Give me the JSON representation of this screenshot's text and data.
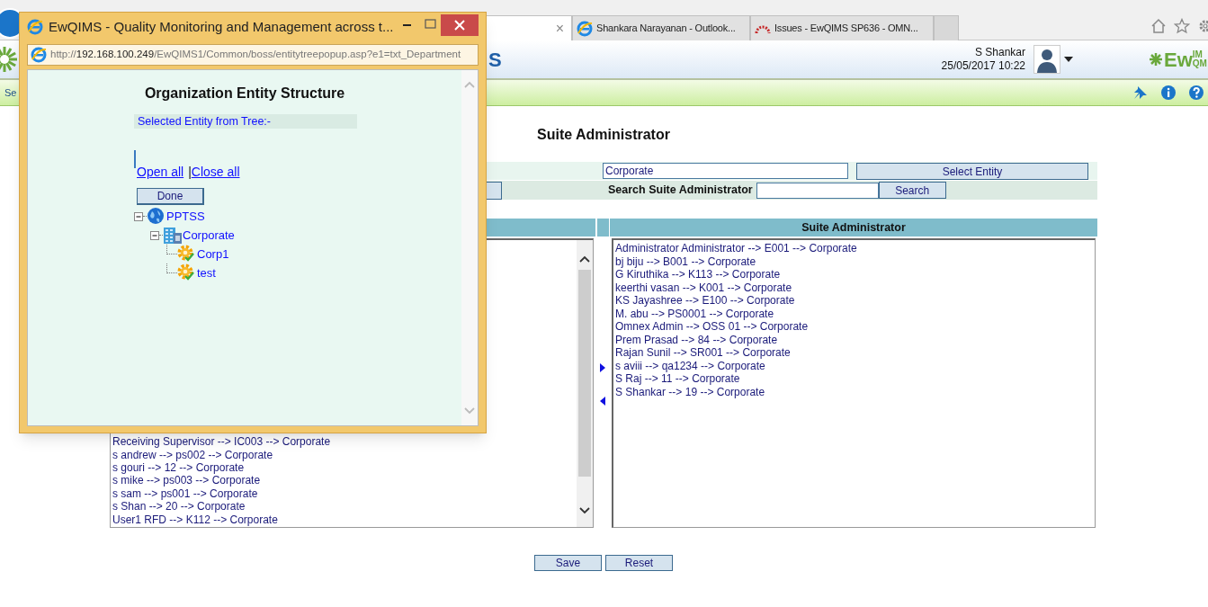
{
  "browser": {
    "tabs": [
      {
        "selected": true,
        "close": "×"
      },
      {
        "title": "Shankara Narayanan - Outlook...",
        "selected": false,
        "kind": "ie"
      },
      {
        "title": "Issues - EwQIMS SP636 - OMN...",
        "selected": false,
        "kind": "arc"
      }
    ]
  },
  "header": {
    "logo_fragment": "S",
    "user": "S Shankar",
    "datetime": "25/05/2017 10:22",
    "brand": "Ew",
    "brand_top": "IM",
    "brand_bottom": "QM"
  },
  "menu_bar": {
    "items": [
      "Se"
    ]
  },
  "page": {
    "title": "Suite Administrator",
    "entity_field": {
      "value": "Corporate"
    },
    "select_entity_button": "Select Entity",
    "search_label": "Search Suite Administrator",
    "search_button": "Search",
    "right_list_header": "Suite Administrator",
    "available_list": [
      "Receiving Supervisor --> IC003 --> Corporate",
      "s andrew --> ps002 --> Corporate",
      "s gouri --> 12 --> Corporate",
      "s mike --> ps003 --> Corporate",
      "s sam --> ps001 --> Corporate",
      "s Shan --> 20 --> Corporate",
      "User1 RFD --> K112 --> Corporate"
    ],
    "assigned_list": [
      "Administrator Administrator --> E001 --> Corporate",
      "bj biju --> B001 --> Corporate",
      "G Kiruthika --> K113 --> Corporate",
      "keerthi vasan --> K001 --> Corporate",
      "KS Jayashree --> E100 --> Corporate",
      "M. abu --> PS0001 --> Corporate",
      "Omnex Admin --> OSS 01 --> Corporate",
      "Prem Prasad --> 84 --> Corporate",
      "Rajan Sunil --> SR001 --> Corporate",
      "s aviii --> qa1234 --> Corporate",
      "S Raj --> 11 --> Corporate",
      "S Shankar --> 19 --> Corporate"
    ],
    "buttons": [
      "Save",
      "Reset"
    ]
  },
  "popup": {
    "title": "EwQIMS - Quality Monitoring and Management across t...",
    "url_scheme": "http://",
    "url_host": "192.168.100.249",
    "url_path": "/EwQIMS1/Common/boss/entitytreepopup.asp?e1=txt_Department",
    "heading": "Organization Entity Structure",
    "selected_label": "Selected Entity from Tree:-",
    "links": [
      "Open all",
      "Close all"
    ],
    "separator": "|",
    "done_button": "Done",
    "tree": [
      {
        "label": "PPTSS",
        "kind": "globe",
        "expanded": true,
        "children": [
          {
            "label": "Corporate",
            "kind": "building",
            "expanded": true,
            "children": [
              {
                "label": "Corp1",
                "kind": "unit"
              },
              {
                "label": "test",
                "kind": "unit"
              }
            ]
          }
        ]
      }
    ]
  }
}
